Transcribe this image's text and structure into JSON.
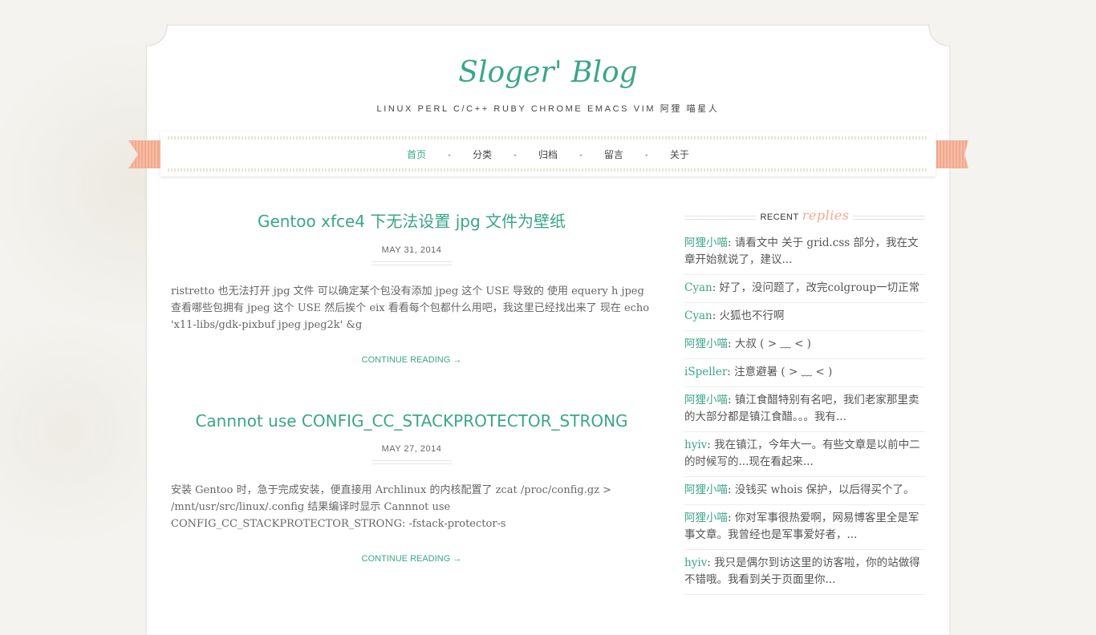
{
  "site": {
    "title": "Sloger' Blog",
    "tagline": "LINUX PERL C/C++ RUBY CHROME EMACS VIM 阿狸 喵星人"
  },
  "nav": {
    "items": [
      "首页",
      "分类",
      "归档",
      "留言",
      "关于"
    ],
    "active": "首页"
  },
  "posts": [
    {
      "title": "Gentoo xfce4 下无法设置 jpg 文件为壁纸",
      "date": "MAY 31, 2014",
      "excerpt": "ristretto 也无法打开 jpg 文件 可以确定某个包没有添加 jpeg 这个 USE 导致的 使用 equery h jpeg 查看哪些包拥有 jpeg 这个 USE 然后挨个 eix 看看每个包都什么用吧，我这里已经找出来了 现在 echo 'x11-libs/gdk-pixbuf jpeg jpeg2k' &g",
      "more": "CONTINUE READING →"
    },
    {
      "title": "Cannnot use CONFIG_CC_STACKPROTECTOR_STRONG",
      "date": "MAY 27, 2014",
      "excerpt": "安装 Gentoo 时，急于完成安装，便直接用 Archlinux 的内核配置了 zcat /proc/config.gz > /mnt/usr/src/linux/.config 结果编译时显示 Cannnot use CONFIG_CC_STACKPROTECTOR_STRONG: -fstack-protector-s",
      "more": "CONTINUE READING →"
    }
  ],
  "sidebar": {
    "recent_label": "RECENT",
    "recent_script": "replies",
    "replies": [
      {
        "who": "阿狸小喵",
        "text": ": 请看文中 关于 grid.css 部分，我在文章开始就说了，建议..."
      },
      {
        "who": "Cyan",
        "text": ": 好了，没问题了，改完colgroup一切正常"
      },
      {
        "who": "Cyan",
        "text": ": 火狐也不行啊"
      },
      {
        "who": "阿狸小喵",
        "text": ": 大叔 ( > ﹏ < )"
      },
      {
        "who": "iSpeller",
        "text": ": 注意避暑 ( > ﹏ < )"
      },
      {
        "who": "阿狸小喵",
        "text": ": 镇江食醋特别有名吧，我们老家那里卖的大部分都是镇江食醋。。。我有..."
      },
      {
        "who": "hyiv",
        "text": ": 我在镇江，今年大一。有些文章是以前中二的时候写的...现在看起来..."
      },
      {
        "who": "阿狸小喵",
        "text": ": 没钱买 whois 保护，以后得买个了。"
      },
      {
        "who": "阿狸小喵",
        "text": ": 你对军事很热爱啊，网易博客里全是军事文章。我曾经也是军事爱好者，..."
      },
      {
        "who": "hyiv",
        "text": ": 我只是偶尔到访这里的访客啦，你的站做得不错哦。我看到关于页面里你..."
      }
    ]
  },
  "colors": {
    "accent": "#3ba58a",
    "ribbon": "#f2a98f"
  }
}
